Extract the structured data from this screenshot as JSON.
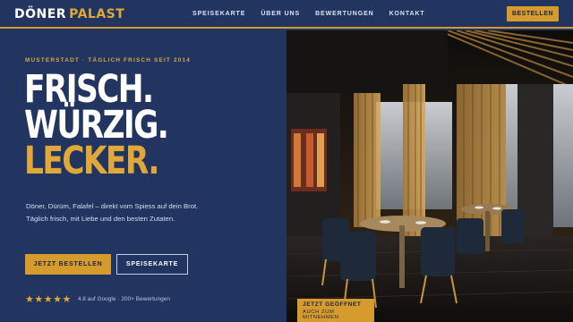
{
  "brand": {
    "name_part1": "DÖNER",
    "name_part2": "PALAST"
  },
  "nav": {
    "items": [
      {
        "label": "SPEISEKARTE"
      },
      {
        "label": "ÜBER UNS"
      },
      {
        "label": "BEWERTUNGEN"
      },
      {
        "label": "KONTAKT"
      }
    ],
    "cta_label": "BESTELLEN"
  },
  "hero": {
    "eyebrow": "MUSTERSTADT · TÄGLICH FRISCH SEIT 2014",
    "headline": {
      "line1": "FRISCH.",
      "line2": "WÜRZIG.",
      "line3": "LECKER."
    },
    "description": "Döner, Dürüm, Falafel – direkt vom Spiess auf dein Brot. Täglich frisch, mit Liebe und den besten Zutaten.",
    "primary_button": "JETZT BESTELLEN",
    "secondary_button": "SPEISEKARTE",
    "rating": {
      "stars": "★★★★★",
      "value": 4.8,
      "text": "4.8 auf Google · 200+ Bewertungen"
    }
  },
  "badge": {
    "title": "JETZT GEÖFFNET",
    "subtitle": "AUCH ZUM MITNEHMEN"
  },
  "colors": {
    "navy": "#213560",
    "gold": "#d59b2c",
    "gold_text": "#e0a838"
  }
}
